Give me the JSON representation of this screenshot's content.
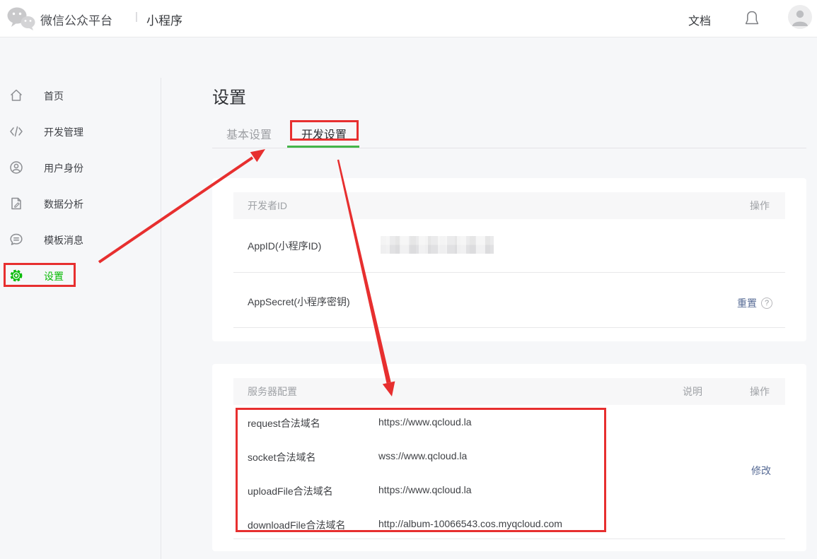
{
  "header": {
    "brand": "微信公众平台",
    "separator": "|",
    "product": "小程序",
    "doc_link": "文档"
  },
  "sidebar": {
    "items": [
      {
        "label": "首页",
        "icon": "home-icon",
        "active": false
      },
      {
        "label": "开发管理",
        "icon": "code-icon",
        "active": false
      },
      {
        "label": "用户身份",
        "icon": "user-icon",
        "active": false
      },
      {
        "label": "数据分析",
        "icon": "data-analysis-icon",
        "active": false
      },
      {
        "label": "模板消息",
        "icon": "message-icon",
        "active": false
      },
      {
        "label": "设置",
        "icon": "gear-icon",
        "active": true,
        "annotated": true
      }
    ]
  },
  "main": {
    "title": "设置",
    "tabs": [
      {
        "label": "基本设置",
        "active": false
      },
      {
        "label": "开发设置",
        "active": true,
        "annotated": true
      }
    ],
    "developer_id_section": {
      "title": "开发者ID",
      "action_header": "操作",
      "rows": [
        {
          "label": "AppID(小程序ID)",
          "value": "",
          "value_redacted": true
        },
        {
          "label": "AppSecret(小程序密钥)",
          "action": "重置",
          "help": "?"
        }
      ]
    },
    "server_config_section": {
      "title": "服务器配置",
      "note_header": "说明",
      "action_header": "操作",
      "action": "修改",
      "rows": [
        {
          "label": "request合法域名",
          "value": "https://www.qcloud.la"
        },
        {
          "label": "socket合法域名",
          "value": "wss://www.qcloud.la"
        },
        {
          "label": "uploadFile合法域名",
          "value": "https://www.qcloud.la"
        },
        {
          "label": "downloadFile合法域名",
          "value": "http://album-10066543.cos.myqcloud.com"
        }
      ]
    }
  },
  "colors": {
    "wechat_green": "#09bb07",
    "tab_underline_green": "#44b549",
    "annotation_red": "#e72f2f",
    "link_blue": "#576b95"
  }
}
